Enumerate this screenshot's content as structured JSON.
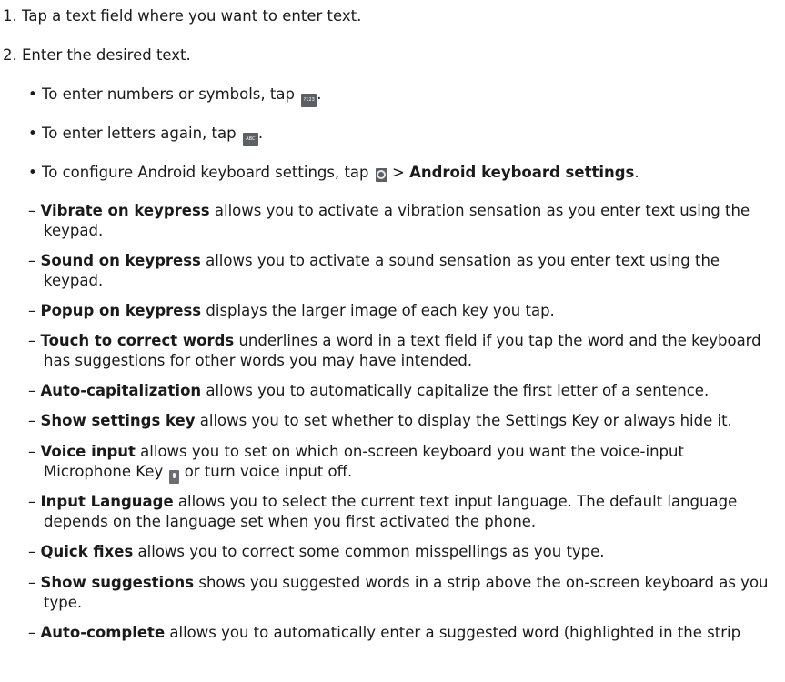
{
  "steps": [
    "1. Tap a text field where you want to enter text.",
    "2. Enter the desired text."
  ],
  "bullets": {
    "numbers": {
      "text": "• To enter numbers or symbols, tap ",
      "key_label": "?123",
      "after": "."
    },
    "letters": {
      "text": "• To enter letters again, tap ",
      "key_label": "ABC",
      "after": "."
    },
    "settings": {
      "text": "• To configure Android keyboard settings, tap ",
      "sep": " > ",
      "link": "Android keyboard settings",
      "after": "."
    }
  },
  "settings_items": [
    {
      "term": "Vibrate on keypress",
      "l1": " allows you to activate a vibration sensation as you enter text using the",
      "l2": "keypad."
    },
    {
      "term": "Sound on keypress",
      "l1": " allows you to activate a sound sensation as you enter text using the",
      "l2": "keypad."
    },
    {
      "term": "Popup on keypress",
      "l1": " displays the larger image of each key you tap."
    },
    {
      "term": "Touch to correct words",
      "l1": " underlines a word in a text field if you tap the word and the keyboard",
      "l2": "has suggestions for other words you may have intended."
    },
    {
      "term": "Auto-capitalization",
      "l1": " allows you to automatically capitalize the first letter of a sentence."
    },
    {
      "term": "Show settings key",
      "l1": " allows you to set whether to display the Settings Key or always hide it."
    },
    {
      "term": "Voice input",
      "l1": " allows you to set on which on-screen keyboard you want the voice-input",
      "l2a": "Microphone Key ",
      "l2b": " or turn voice input off."
    },
    {
      "term": "Input Language",
      "l1": " allows you to select the current text input language. The default language",
      "l2": "depends on the language set when you first activated the phone."
    },
    {
      "term": "Quick fixes",
      "l1": " allows you to correct some common misspellings as you type."
    },
    {
      "term": "Show suggestions",
      "l1": " shows you suggested words in a strip above the on-screen keyboard as you",
      "l2": "type."
    },
    {
      "term": "Auto-complete",
      "l1": " allows you to automatically enter a suggested word (highlighted in the strip"
    }
  ],
  "dash": "– ",
  "icons": {
    "numbers_key": "numbers-symbols-key-icon",
    "letters_key": "abc-key-icon",
    "settings_key": "settings-gear-key-icon",
    "mic_key": "microphone-key-icon"
  }
}
